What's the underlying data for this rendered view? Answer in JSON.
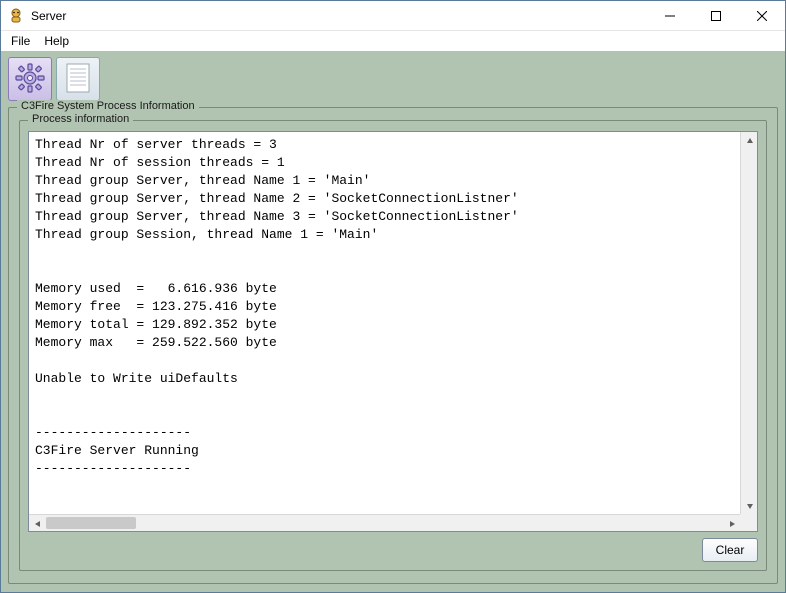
{
  "window": {
    "title": "Server"
  },
  "menu": {
    "file": "File",
    "help": "Help"
  },
  "section": {
    "outer_legend": "C3Fire System Process Information",
    "inner_legend": "Process information"
  },
  "log_text": "Thread Nr of server threads = 3\nThread Nr of session threads = 1\nThread group Server, thread Name 1 = 'Main'\nThread group Server, thread Name 2 = 'SocketConnectionListner'\nThread group Server, thread Name 3 = 'SocketConnectionListner'\nThread group Session, thread Name 1 = 'Main'\n\n\nMemory used  =   6.616.936 byte\nMemory free  = 123.275.416 byte\nMemory total = 129.892.352 byte\nMemory max   = 259.522.560 byte\n\nUnable to Write uiDefaults\n\n\n--------------------\nC3Fire Server Running\n--------------------",
  "buttons": {
    "clear": "Clear"
  }
}
